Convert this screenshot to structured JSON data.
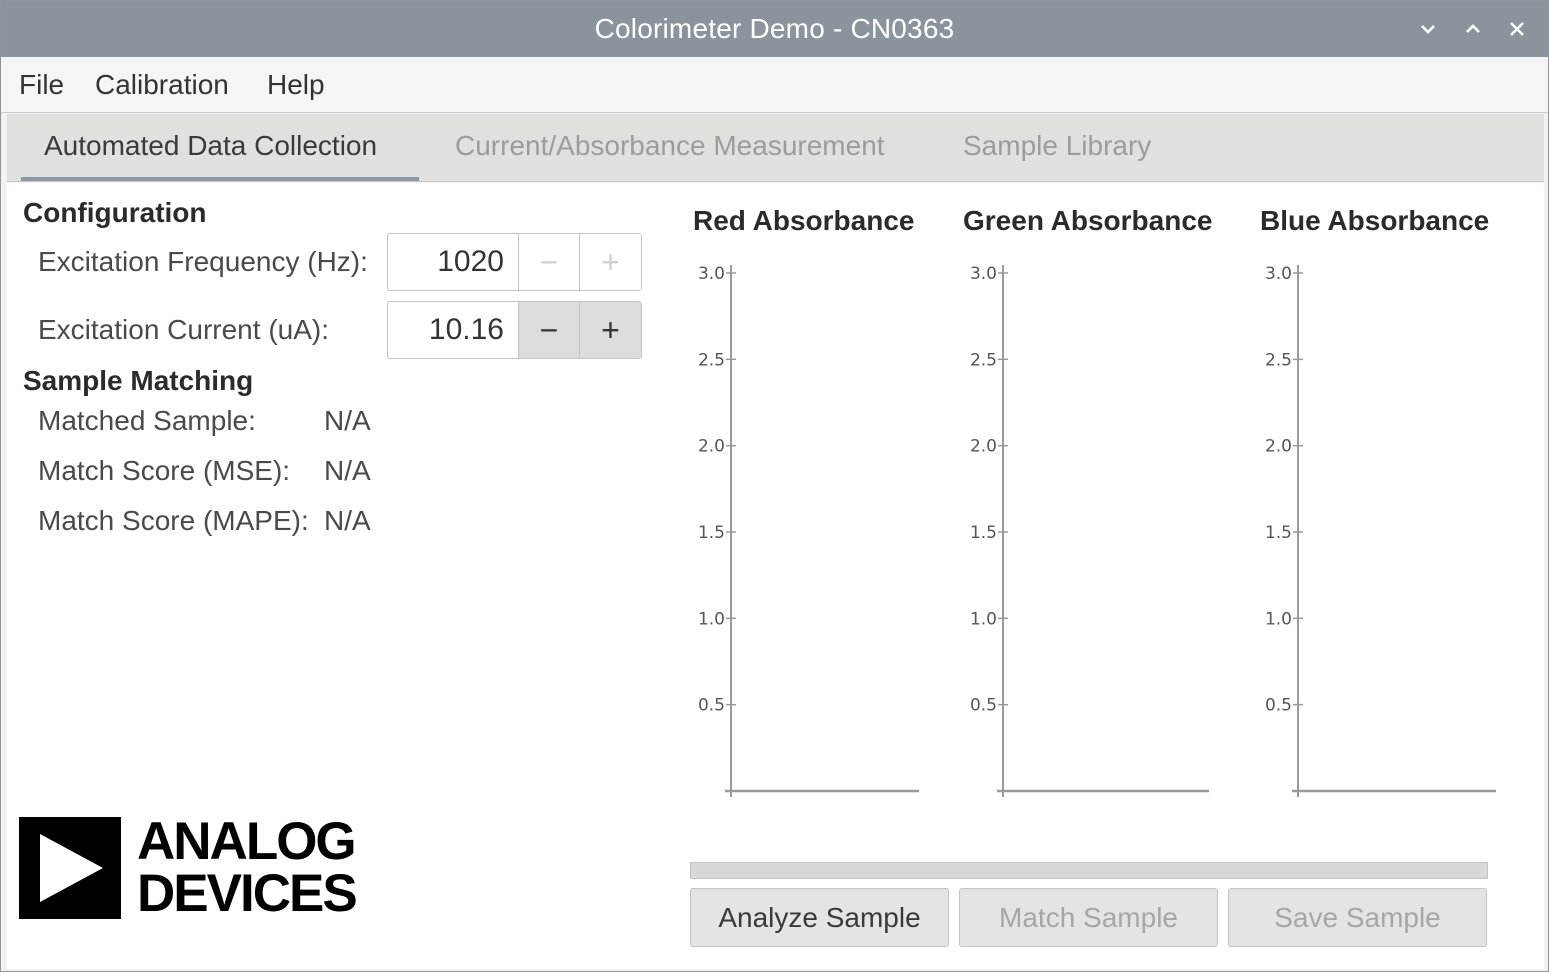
{
  "window": {
    "title": "Colorimeter Demo - CN0363"
  },
  "menubar": {
    "items": [
      "File",
      "Calibration",
      "Help"
    ]
  },
  "tabs": [
    {
      "label": "Automated Data Collection",
      "active": true
    },
    {
      "label": "Current/Absorbance Measurement",
      "active": false
    },
    {
      "label": "Sample Library",
      "active": false
    }
  ],
  "configuration": {
    "heading": "Configuration",
    "frequency": {
      "label": "Excitation Frequency (Hz):",
      "value": "1020",
      "minus": "−",
      "plus": "+"
    },
    "current": {
      "label": "Excitation Current (uA):",
      "value": "10.16",
      "minus": "−",
      "plus": "+"
    }
  },
  "sample_matching": {
    "heading": "Sample Matching",
    "rows": [
      {
        "label": "Matched Sample:",
        "value": "N/A"
      },
      {
        "label": "Match Score (MSE):",
        "value": "N/A"
      },
      {
        "label": "Match Score (MAPE):",
        "value": "N/A"
      }
    ]
  },
  "logo": {
    "line1": "ANALOG",
    "line2": "DEVICES"
  },
  "chart_data": [
    {
      "type": "bar",
      "title": "Red Absorbance",
      "ylim": [
        0,
        3.0
      ],
      "yticks": [
        "0.5",
        "1.0",
        "1.5",
        "2.0",
        "2.5",
        "3.0"
      ],
      "categories": [],
      "values": [],
      "grid": false
    },
    {
      "type": "bar",
      "title": "Green Absorbance",
      "ylim": [
        0,
        3.0
      ],
      "yticks": [
        "0.5",
        "1.0",
        "1.5",
        "2.0",
        "2.5",
        "3.0"
      ],
      "categories": [],
      "values": [],
      "grid": false
    },
    {
      "type": "bar",
      "title": "Blue Absorbance",
      "ylim": [
        0,
        3.0
      ],
      "yticks": [
        "0.5",
        "1.0",
        "1.5",
        "2.0",
        "2.5",
        "3.0"
      ],
      "categories": [],
      "values": [],
      "grid": false
    }
  ],
  "progress": {
    "value": 0
  },
  "actions": {
    "analyze": "Analyze Sample",
    "match": "Match Sample",
    "save": "Save Sample"
  },
  "colors": {
    "titlebar": "#8b949c",
    "axis": "#9a9a9a"
  }
}
